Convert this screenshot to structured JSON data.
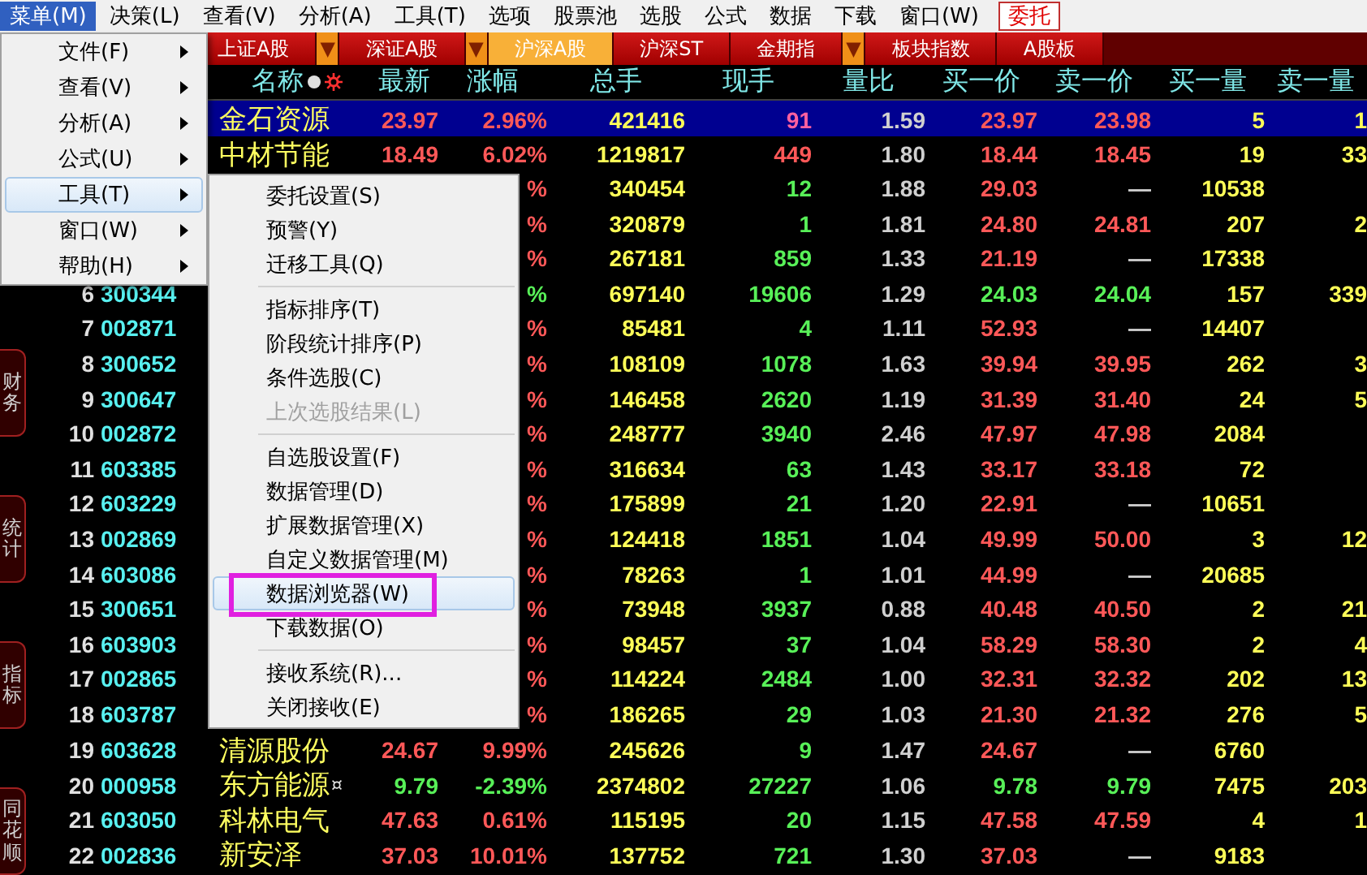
{
  "menu_bar": [
    {
      "label": "菜单(M)",
      "kind": "menu",
      "selected": true
    },
    {
      "label": "决策(L)",
      "kind": "menu",
      "selected": false
    },
    {
      "label": "查看(V)",
      "kind": "menu",
      "selected": false
    },
    {
      "label": "分析(A)",
      "kind": "menu",
      "selected": false
    },
    {
      "label": "工具(T)",
      "kind": "menu",
      "selected": false
    },
    {
      "label": "选项",
      "kind": "menu",
      "selected": false
    },
    {
      "label": "股票池",
      "kind": "menu",
      "selected": false
    },
    {
      "label": "选股",
      "kind": "menu",
      "selected": false
    },
    {
      "label": "公式",
      "kind": "menu",
      "selected": false
    },
    {
      "label": "数据",
      "kind": "menu",
      "selected": false
    },
    {
      "label": "下载",
      "kind": "menu",
      "selected": false
    },
    {
      "label": "窗口(W)",
      "kind": "menu",
      "selected": false
    },
    {
      "label": "委托",
      "kind": "trade",
      "selected": false
    }
  ],
  "tabs": [
    {
      "label": "上证A股",
      "kind": "tab",
      "selected": false
    },
    {
      "label": "▼",
      "kind": "dropdown",
      "selected": false
    },
    {
      "label": "深证A股",
      "kind": "tab",
      "selected": false
    },
    {
      "label": "▼",
      "kind": "dropdown",
      "selected": false
    },
    {
      "label": "沪深A股",
      "kind": "tab",
      "selected": true
    },
    {
      "label": "沪深ST",
      "kind": "tab",
      "selected": false
    },
    {
      "label": "金期指",
      "kind": "tab",
      "selected": false
    },
    {
      "label": "▼",
      "kind": "dropdown",
      "selected": false
    },
    {
      "label": "板块指数",
      "kind": "tab",
      "selected": false
    },
    {
      "label": "A股板",
      "kind": "tab",
      "selected": false
    }
  ],
  "columns": [
    "名称",
    "最新",
    "涨幅",
    "总手",
    "现手",
    "量比",
    "买一价",
    "卖一价",
    "买一量",
    "卖一量"
  ],
  "rows": [
    {
      "selected": true,
      "rising": true,
      "buy_tick": true,
      "has_ask": true,
      "name": "金石资源",
      "price": "23.97",
      "change": "2.96%",
      "volume": "421416",
      "current": "91",
      "ratio": "1.59",
      "bid": "23.97",
      "ask": "23.98",
      "bid_vol": "5",
      "ask_vol": "1"
    },
    {
      "selected": false,
      "rising": true,
      "buy_tick": true,
      "has_ask": true,
      "name": "中材节能",
      "price": "18.49",
      "change": "6.02%",
      "volume": "1219817",
      "current": "449",
      "ratio": "1.80",
      "bid": "18.44",
      "ask": "18.45",
      "bid_vol": "19",
      "ask_vol": "33"
    },
    {
      "selected": false,
      "rising": true,
      "buy_tick": false,
      "has_ask": false,
      "change": "%",
      "volume": "340454",
      "current": "12",
      "ratio": "1.88",
      "bid": "29.03",
      "ask": "—",
      "bid_vol": "10538"
    },
    {
      "selected": false,
      "rising": true,
      "buy_tick": false,
      "has_ask": true,
      "change": "%",
      "volume": "320879",
      "current": "1",
      "ratio": "1.81",
      "bid": "24.80",
      "ask": "24.81",
      "bid_vol": "207",
      "ask_vol": "2"
    },
    {
      "selected": false,
      "rising": true,
      "buy_tick": false,
      "has_ask": false,
      "change": "%",
      "volume": "267181",
      "current": "859",
      "ratio": "1.33",
      "bid": "21.19",
      "ask": "—",
      "bid_vol": "17338"
    },
    {
      "selected": false,
      "rising": false,
      "buy_tick": false,
      "has_ask": true,
      "number": "6",
      "code": "300344",
      "change": "%",
      "volume": "697140",
      "current": "19606",
      "ratio": "1.29",
      "bid": "24.03",
      "ask": "24.04",
      "bid_vol": "157",
      "ask_vol": "339"
    },
    {
      "selected": false,
      "rising": true,
      "buy_tick": false,
      "has_ask": false,
      "number": "7",
      "code": "002871",
      "change": "%",
      "volume": "85481",
      "current": "4",
      "ratio": "1.11",
      "bid": "52.93",
      "ask": "—",
      "bid_vol": "14407"
    },
    {
      "selected": false,
      "rising": true,
      "buy_tick": false,
      "has_ask": true,
      "number": "8",
      "code": "300652",
      "change": "%",
      "volume": "108109",
      "current": "1078",
      "ratio": "1.63",
      "bid": "39.94",
      "ask": "39.95",
      "bid_vol": "262",
      "ask_vol": "3"
    },
    {
      "selected": false,
      "rising": true,
      "buy_tick": false,
      "has_ask": true,
      "number": "9",
      "code": "300647",
      "change": "%",
      "volume": "146458",
      "current": "2620",
      "ratio": "1.19",
      "bid": "31.39",
      "ask": "31.40",
      "bid_vol": "24",
      "ask_vol": "5"
    },
    {
      "selected": false,
      "rising": true,
      "buy_tick": false,
      "has_ask": true,
      "number": "10",
      "code": "002872",
      "change": "%",
      "volume": "248777",
      "current": "3940",
      "ratio": "2.46",
      "bid": "47.97",
      "ask": "47.98",
      "bid_vol": "2084"
    },
    {
      "selected": false,
      "rising": true,
      "buy_tick": false,
      "has_ask": true,
      "number": "11",
      "code": "603385",
      "change": "%",
      "volume": "316634",
      "current": "63",
      "ratio": "1.43",
      "bid": "33.17",
      "ask": "33.18",
      "bid_vol": "72"
    },
    {
      "selected": false,
      "rising": true,
      "buy_tick": false,
      "has_ask": false,
      "number": "12",
      "code": "603229",
      "change": "%",
      "volume": "175899",
      "current": "21",
      "ratio": "1.20",
      "bid": "22.91",
      "ask": "—",
      "bid_vol": "10651"
    },
    {
      "selected": false,
      "rising": true,
      "buy_tick": false,
      "has_ask": true,
      "number": "13",
      "code": "002869",
      "change": "%",
      "volume": "124418",
      "current": "1851",
      "ratio": "1.04",
      "bid": "49.99",
      "ask": "50.00",
      "bid_vol": "3",
      "ask_vol": "12"
    },
    {
      "selected": false,
      "rising": true,
      "buy_tick": false,
      "has_ask": false,
      "number": "14",
      "code": "603086",
      "change": "%",
      "volume": "78263",
      "current": "1",
      "ratio": "1.01",
      "bid": "44.99",
      "ask": "—",
      "bid_vol": "20685"
    },
    {
      "selected": false,
      "rising": true,
      "buy_tick": false,
      "has_ask": true,
      "number": "15",
      "code": "300651",
      "change": "%",
      "volume": "73948",
      "current": "3937",
      "ratio": "0.88",
      "bid": "40.48",
      "ask": "40.50",
      "bid_vol": "2",
      "ask_vol": "21"
    },
    {
      "selected": false,
      "rising": true,
      "buy_tick": false,
      "has_ask": true,
      "number": "16",
      "code": "603903",
      "change": "%",
      "volume": "98457",
      "current": "37",
      "ratio": "1.04",
      "bid": "58.29",
      "ask": "58.30",
      "bid_vol": "2",
      "ask_vol": "4"
    },
    {
      "selected": false,
      "rising": true,
      "buy_tick": false,
      "has_ask": true,
      "number": "17",
      "code": "002865",
      "change": "%",
      "volume": "114224",
      "current": "2484",
      "ratio": "1.00",
      "bid": "32.31",
      "ask": "32.32",
      "bid_vol": "202",
      "ask_vol": "13"
    },
    {
      "selected": false,
      "rising": true,
      "buy_tick": false,
      "has_ask": true,
      "number": "18",
      "code": "603787",
      "change": "%",
      "volume": "186265",
      "current": "29",
      "ratio": "1.03",
      "bid": "21.30",
      "ask": "21.32",
      "bid_vol": "276",
      "ask_vol": "5"
    },
    {
      "selected": false,
      "rising": true,
      "buy_tick": false,
      "has_ask": false,
      "number": "19",
      "code": "603628",
      "name": "清源股份",
      "price": "24.67",
      "change": "9.99%",
      "volume": "245626",
      "current": "9",
      "ratio": "1.47",
      "bid": "24.67",
      "ask": "—",
      "bid_vol": "6760"
    },
    {
      "selected": false,
      "rising": false,
      "buy_tick": false,
      "has_ask": true,
      "number": "20",
      "code": "000958",
      "name": "东方能源",
      "name_mark": "¤",
      "price": "9.79",
      "change": "-2.39%",
      "volume": "2374802",
      "current": "27227",
      "ratio": "1.06",
      "bid": "9.78",
      "ask": "9.79",
      "bid_vol": "7475",
      "ask_vol": "203"
    },
    {
      "selected": false,
      "rising": true,
      "buy_tick": false,
      "has_ask": true,
      "number": "21",
      "code": "603050",
      "name": "科林电气",
      "price": "47.63",
      "change": "0.61%",
      "volume": "115195",
      "current": "20",
      "ratio": "1.15",
      "bid": "47.58",
      "ask": "47.59",
      "bid_vol": "4",
      "ask_vol": "1"
    },
    {
      "selected": false,
      "rising": true,
      "buy_tick": false,
      "has_ask": false,
      "number": "22",
      "code": "002836",
      "name": "新安泽",
      "price": "37.03",
      "change": "10.01%",
      "volume": "137752",
      "current": "721",
      "ratio": "1.30",
      "bid": "37.03",
      "ask": "—",
      "bid_vol": "9183"
    }
  ],
  "side_tabs": [
    "财务",
    "统计",
    "指标",
    "同花顺"
  ],
  "menu": [
    {
      "label": "文件(F)",
      "selected": false
    },
    {
      "label": "查看(V)",
      "selected": false
    },
    {
      "label": "分析(A)",
      "selected": false
    },
    {
      "label": "公式(U)",
      "selected": false
    },
    {
      "label": "工具(T)",
      "selected": true
    },
    {
      "label": "窗口(W)",
      "selected": false
    },
    {
      "label": "帮助(H)",
      "selected": false
    }
  ],
  "submenu": [
    [
      {
        "label": "委托设置(S)",
        "disabled": false,
        "selected": false
      },
      {
        "label": "预警(Y)",
        "disabled": false,
        "selected": false
      },
      {
        "label": "迁移工具(Q)",
        "disabled": false,
        "selected": false
      }
    ],
    [
      {
        "label": "指标排序(T)",
        "disabled": false,
        "selected": false
      },
      {
        "label": "阶段统计排序(P)",
        "disabled": false,
        "selected": false
      },
      {
        "label": "条件选股(C)",
        "disabled": false,
        "selected": false
      },
      {
        "label": "上次选股结果(L)",
        "disabled": true,
        "selected": false
      }
    ],
    [
      {
        "label": "自选股设置(F)",
        "disabled": false,
        "selected": false
      },
      {
        "label": "数据管理(D)",
        "disabled": false,
        "selected": false
      },
      {
        "label": "扩展数据管理(X)",
        "disabled": false,
        "selected": false
      },
      {
        "label": "自定义数据管理(M)",
        "disabled": false,
        "selected": false
      },
      {
        "label": "数据浏览器(W)",
        "disabled": false,
        "selected": true,
        "highlighted": true
      },
      {
        "label": "下载数据(O)",
        "disabled": false,
        "selected": false
      }
    ],
    [
      {
        "label": "接收系统(R)...",
        "disabled": false,
        "selected": false
      },
      {
        "label": "关闭接收(E)",
        "disabled": false,
        "selected": false
      }
    ]
  ]
}
